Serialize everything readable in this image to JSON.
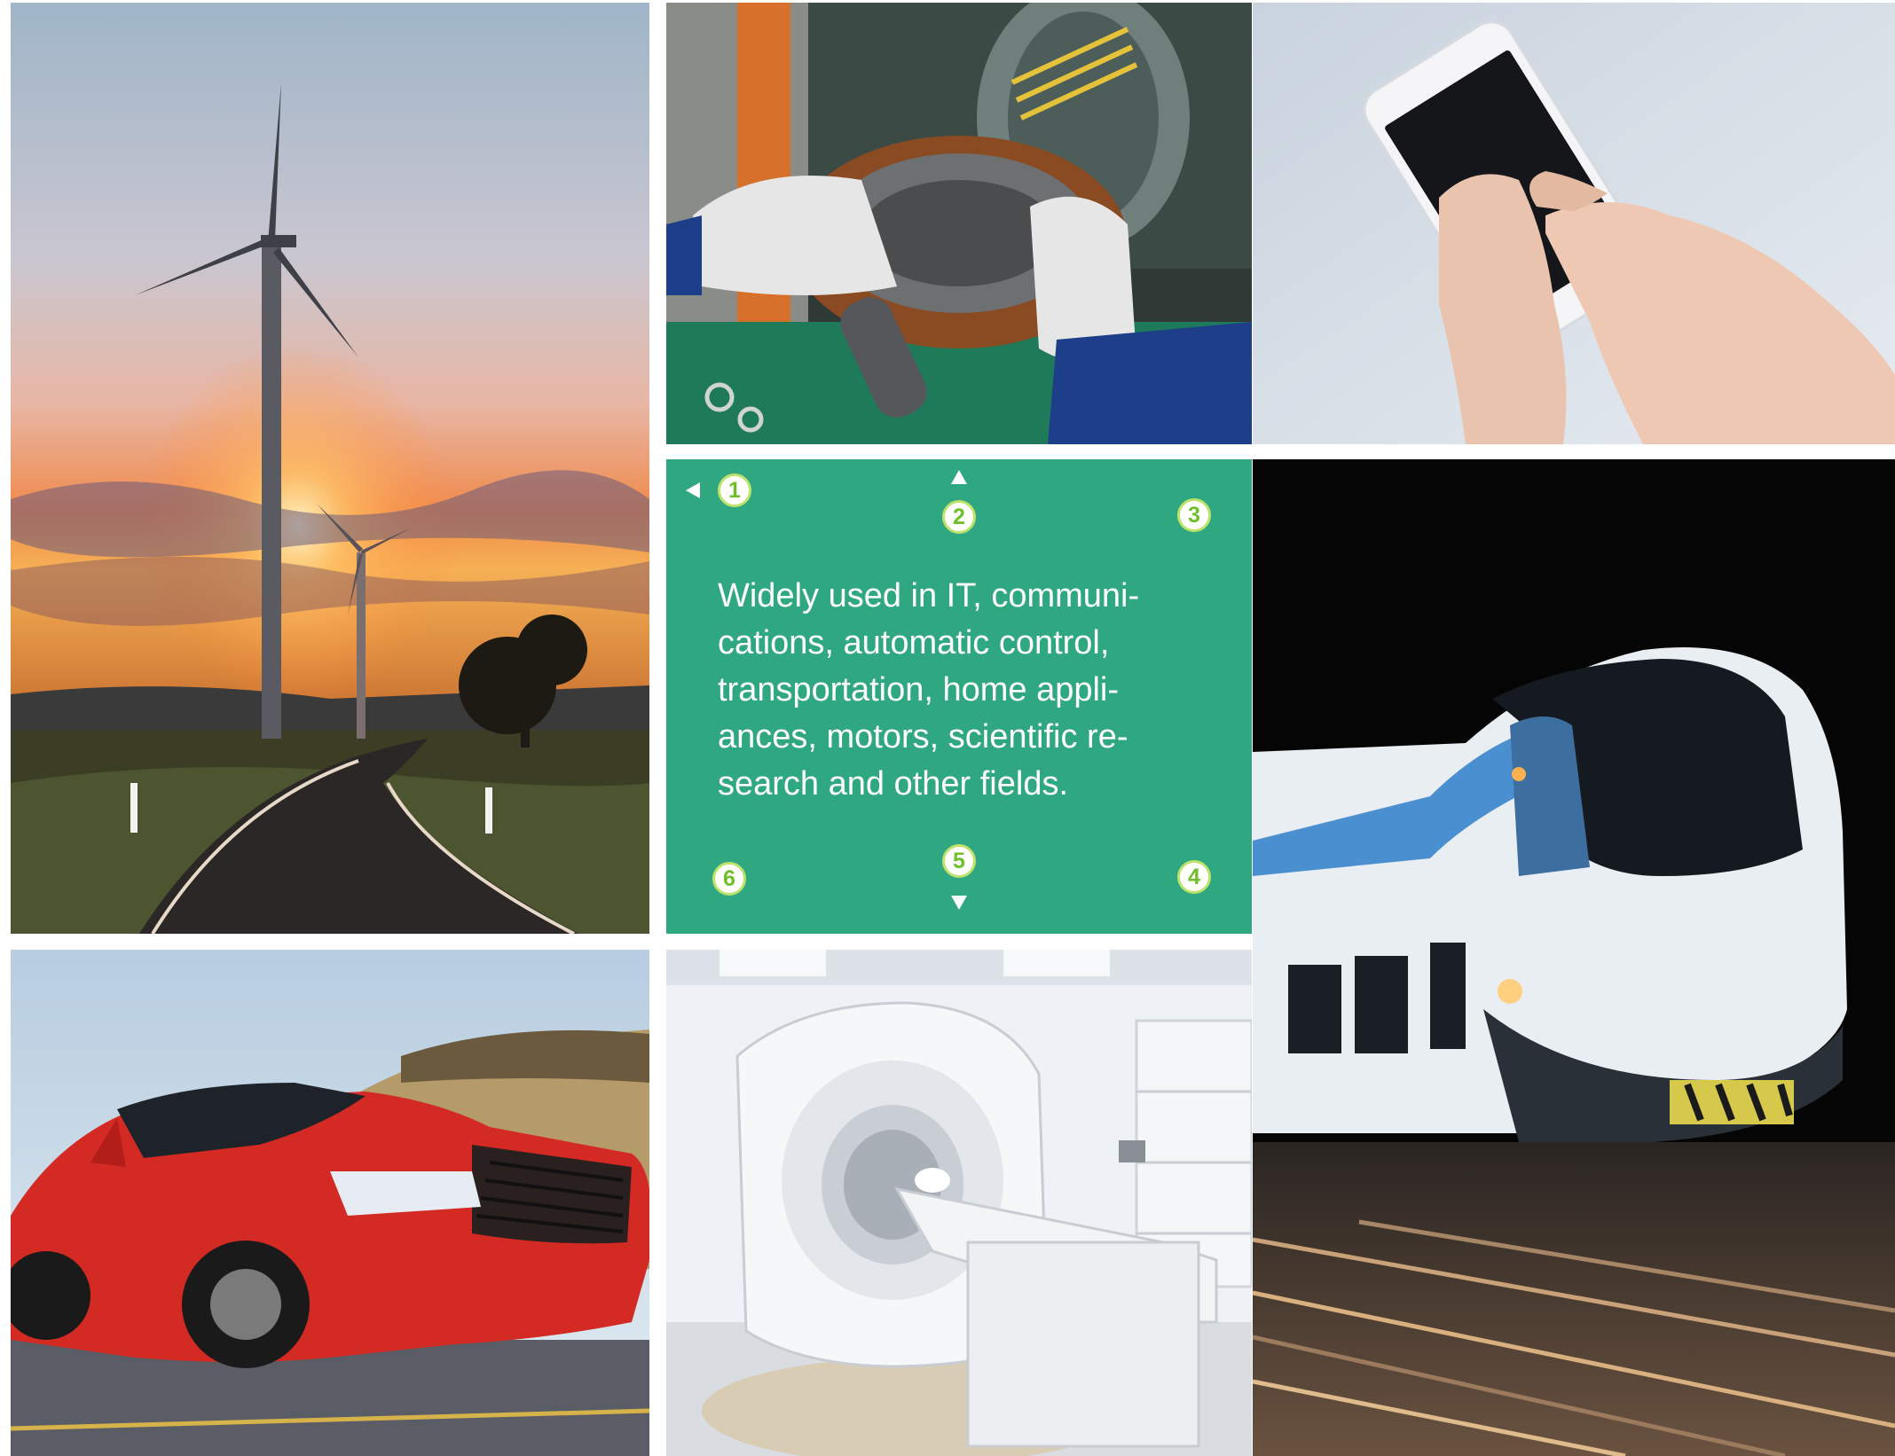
{
  "panel": {
    "text": "Widely used in IT, communi-\ncations, automatic control,\ntransportation, home appli-\nances, motors, scientific re-\nsearch and other fields.",
    "background_color": "#2fa882",
    "markers": [
      "1",
      "2",
      "3",
      "4",
      "5",
      "6"
    ]
  },
  "tiles": [
    {
      "name": "wind-turbines-sunset-photo"
    },
    {
      "name": "motor-stator-winding-photo"
    },
    {
      "name": "smartphone-touch-photo"
    },
    {
      "name": "high-speed-train-photo"
    },
    {
      "name": "red-car-driving-photo"
    },
    {
      "name": "mri-scanner-room-photo"
    }
  ]
}
